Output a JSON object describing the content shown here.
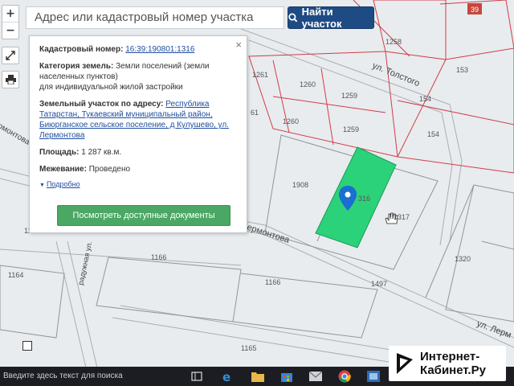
{
  "search": {
    "placeholder": "Адрес или кадастровый номер участка",
    "button_label": "Найти участок"
  },
  "zoom": {
    "in": "+",
    "out": "−"
  },
  "popup": {
    "cadastral_label": "Кадастровый номер:",
    "cadastral_value": "16:39:190801:1316",
    "category_label": "Категория земель:",
    "category_value": "Земли поселений (земли населенных пунктов)",
    "usage_value": "для индивидуальной жилой застройки",
    "address_label": "Земельный участок по адресу:",
    "address_value": "Республика Татарстан, Тукаевский муниципальный район, Биюрганское сельское поселение, д Кулушево, ул. Лермонтова",
    "area_label": "Площадь:",
    "area_value": "1 287 кв.м.",
    "survey_label": "Межевание:",
    "survey_value": "Проведено",
    "more_label": "Подробно",
    "docs_button": "Посмотреть доступные документы",
    "close": "×"
  },
  "map": {
    "streets": [
      "ул. Толстого",
      "Лермонтова",
      "радужная ул.",
      "ул. Лерм"
    ],
    "parcels": [
      "1258",
      "153",
      "1261",
      "1260",
      "1259",
      "154",
      "61",
      "1260",
      "1259",
      "154",
      "1908",
      "316",
      "1317",
      "1320",
      "1166",
      "1166",
      "1166",
      "1164",
      "1165",
      "1497"
    ],
    "corner_badge": "39"
  },
  "taskbar": {
    "search_placeholder": "Введите здесь текст для поиска"
  },
  "watermark": {
    "line1": "Интернет-",
    "line2": "Кабинет.Ру"
  },
  "colors": {
    "parcel_border": "#d23c4a",
    "selected_parcel": "#2bd27a",
    "search_button": "#1f4b85",
    "docs_button": "#4aa864",
    "marker": "#1a6fd0"
  }
}
